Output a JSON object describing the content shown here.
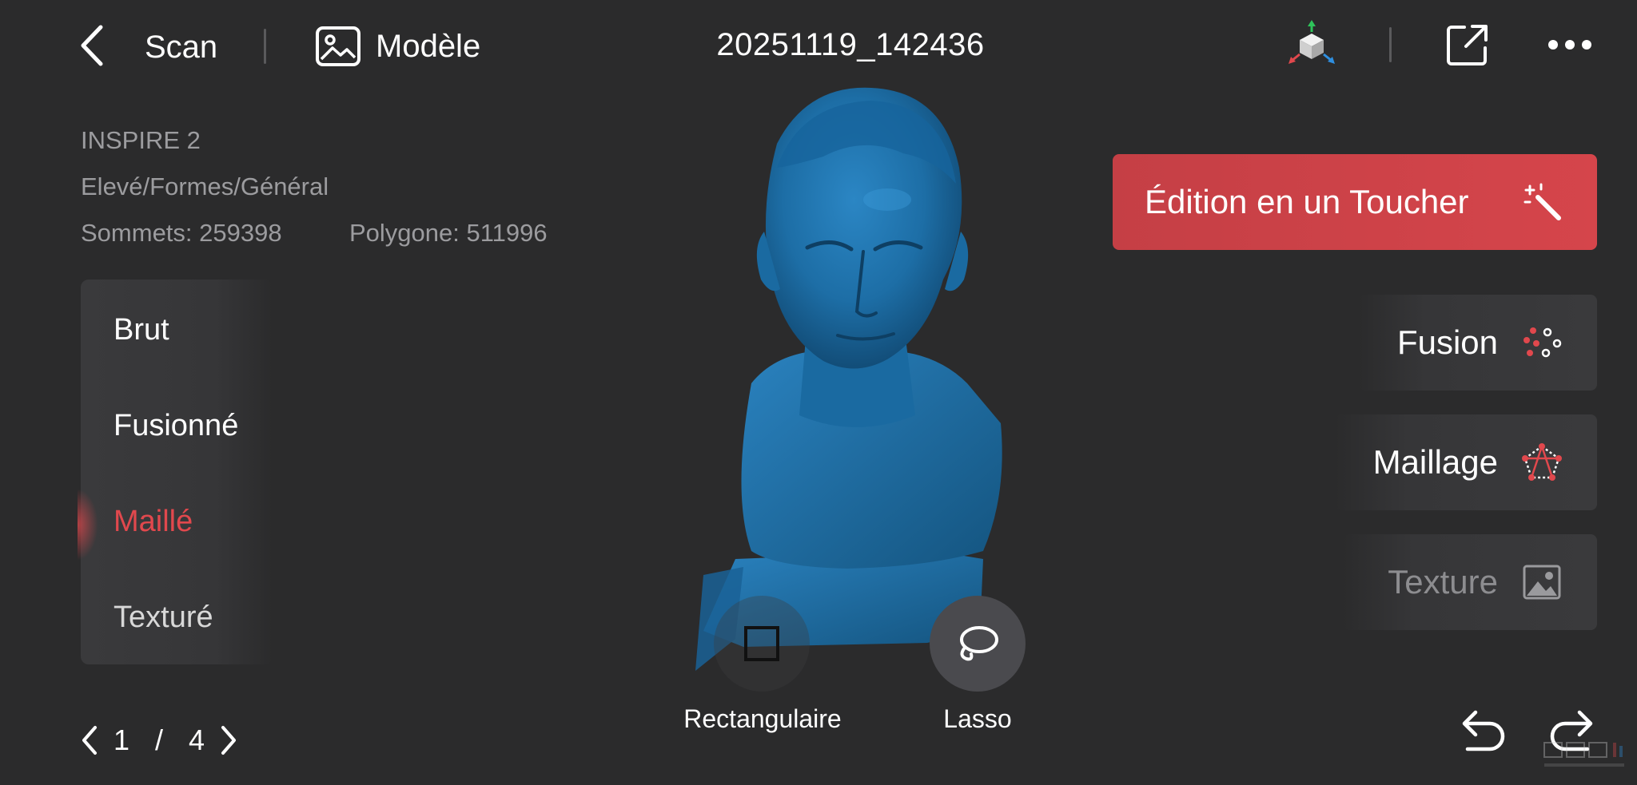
{
  "topbar": {
    "back_label": "Scan",
    "model_label": "Modèle",
    "title": "20251119_142436"
  },
  "info": {
    "device": "INSPIRE 2",
    "profile": "Elevé/Formes/Général",
    "vertices": "Sommets: 259398",
    "polygons": "Polygone: 511996"
  },
  "modes": {
    "items": [
      {
        "label": "Brut",
        "state": "normal"
      },
      {
        "label": "Fusionné",
        "state": "normal"
      },
      {
        "label": "Maillé",
        "state": "selected"
      },
      {
        "label": "Texturé",
        "state": "normal"
      }
    ]
  },
  "pager": {
    "current": "1",
    "separator": "/",
    "total": "4"
  },
  "tools": {
    "rect_label": "Rectangulaire",
    "lasso_label": "Lasso"
  },
  "actions": {
    "one_touch_label": "Édition en un Toucher",
    "fusion_label": "Fusion",
    "mesh_label": "Maillage",
    "texture_label": "Texture"
  },
  "icons": {
    "back": "chevron-left-icon",
    "model": "image-icon",
    "axis": "axis-cube-icon",
    "export": "export-icon",
    "more": "more-dots-icon",
    "wand": "magic-wand-icon",
    "fusion": "dots-fusion-icon",
    "mesh": "mesh-icon",
    "texture": "image-icon",
    "undo": "undo-icon",
    "redo": "redo-icon"
  },
  "colors": {
    "background": "#2b2b2c",
    "accent": "#e1484d",
    "model": "#1d6ea6",
    "muted_text": "#9c9c9f"
  }
}
